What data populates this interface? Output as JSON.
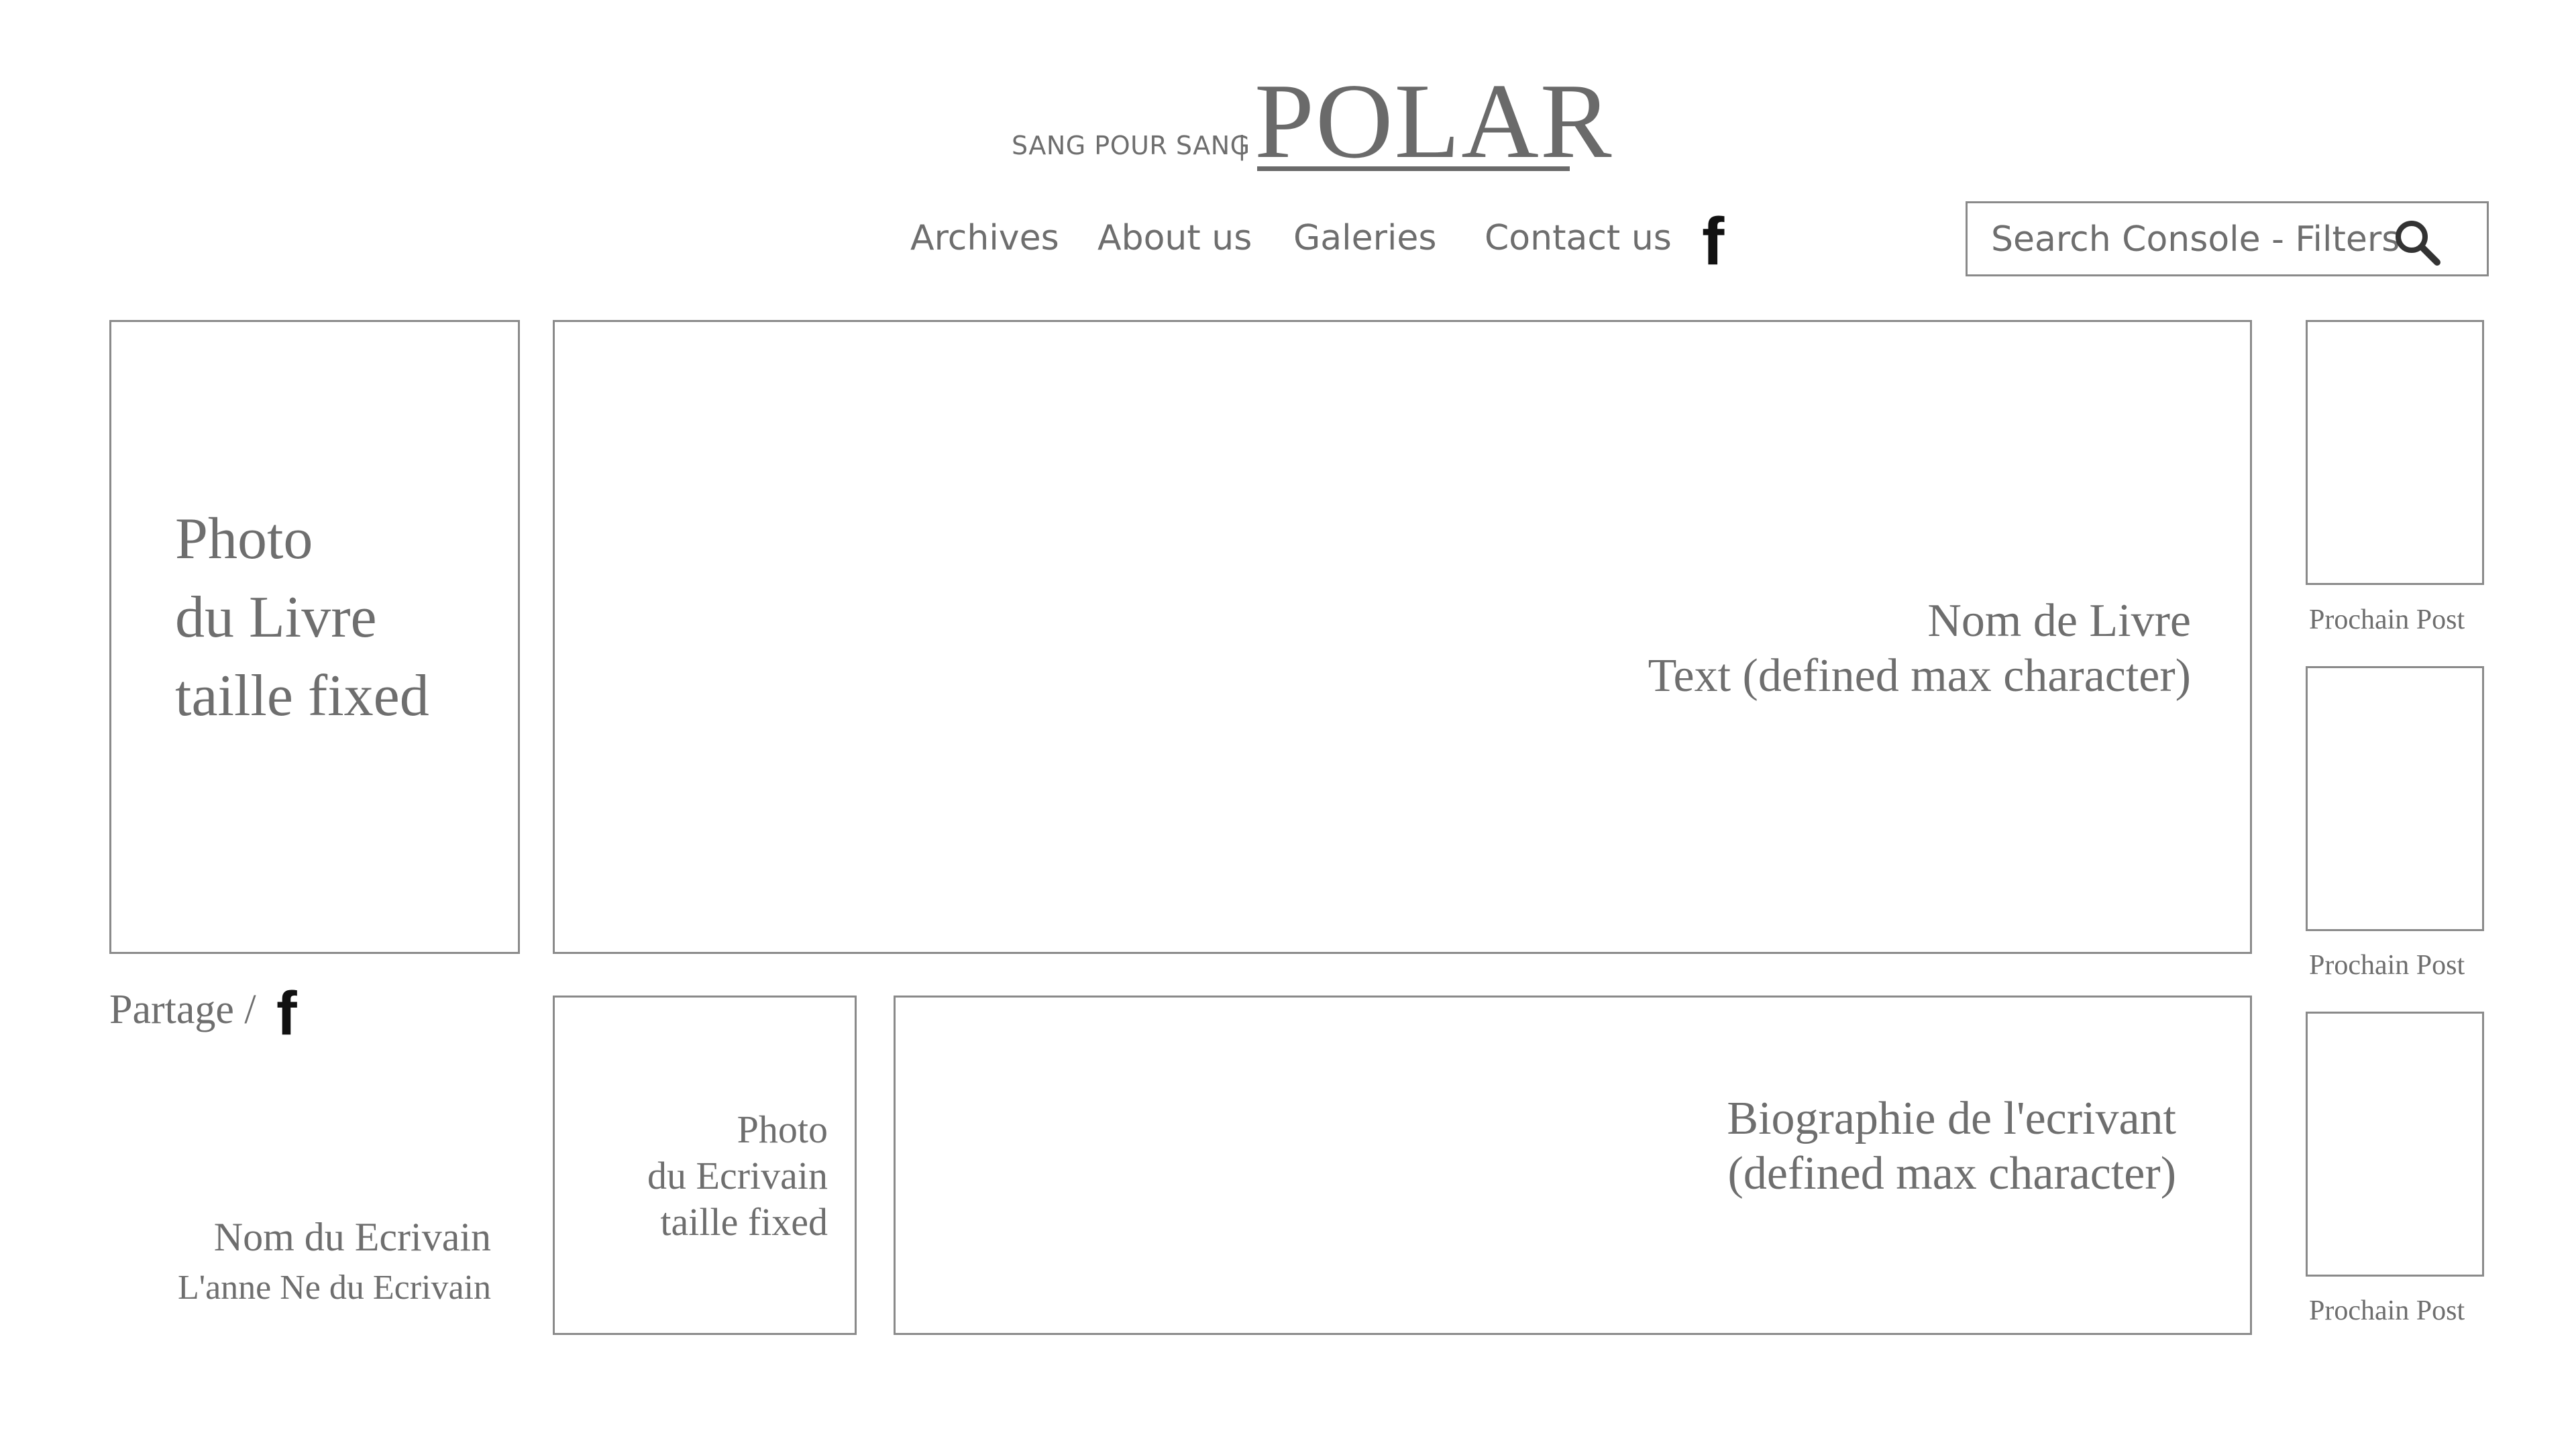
{
  "header": {
    "subtitle": "SANG POUR SANG",
    "separator": "|",
    "title": "POLAR"
  },
  "nav": {
    "items": [
      "Archives",
      "About us",
      "Galeries",
      "Contact us"
    ],
    "facebook_icon": "facebook-icon",
    "facebook_glyph": "f"
  },
  "search": {
    "placeholder": "Search Console - Filters",
    "icon": "search-icon"
  },
  "book": {
    "photo_lines": [
      "Photo",
      "du Livre",
      "taille fixed"
    ],
    "name": "Nom de Livre",
    "text": "Text (defined max character)"
  },
  "share": {
    "label": "Partage /",
    "icon": "facebook-icon",
    "glyph": "f"
  },
  "author": {
    "name": "Nom du Ecrivain",
    "birth_year": "L'anne Ne du Ecrivain",
    "photo_lines": [
      "Photo",
      "du Ecrivain",
      "taille fixed"
    ],
    "bio_lines": [
      "Biographie de l'ecrivant",
      "(defined max character)"
    ]
  },
  "sidebar": {
    "next_posts": [
      "Prochain Post",
      "Prochain Post",
      "Prochain Post"
    ]
  },
  "colors": {
    "text": "#6e6e6e",
    "border": "#8a8a8a",
    "icon": "#111111",
    "background": "#ffffff"
  }
}
